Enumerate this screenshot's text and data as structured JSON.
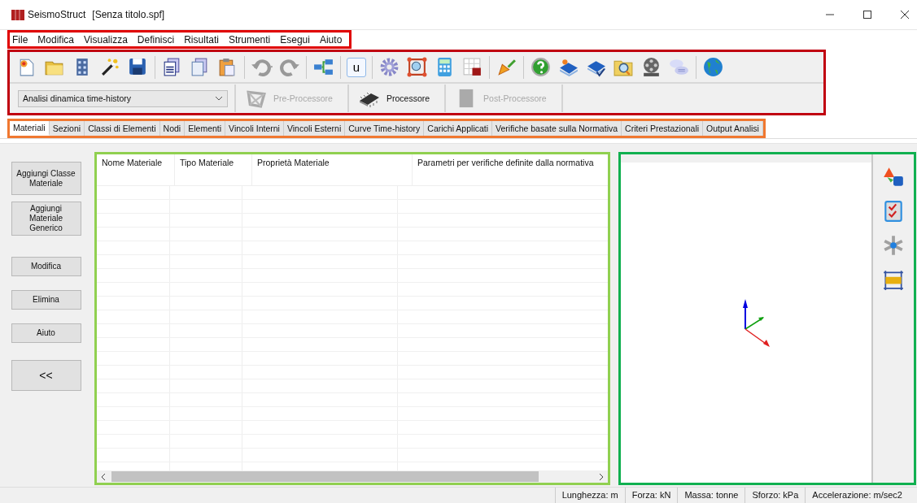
{
  "window": {
    "title": "SeismoStruct",
    "document": "[Senza titolo.spf]"
  },
  "menu": [
    "File",
    "Modifica",
    "Visualizza",
    "Definisci",
    "Risultati",
    "Strumenti",
    "Esegui",
    "Aiuto"
  ],
  "toolbar": {
    "text_button": "u"
  },
  "analysis": {
    "value": "Analisi dinamica time-history"
  },
  "modules": [
    {
      "label": "Pre-Processore",
      "kind": "pre",
      "disabled": true
    },
    {
      "label": "Processore",
      "kind": "proc",
      "disabled": false
    },
    {
      "label": "Post-Processore",
      "kind": "post",
      "disabled": true
    }
  ],
  "tabs": [
    {
      "label": "Materiali",
      "selected": true
    },
    {
      "label": "Sezioni",
      "selected": false
    },
    {
      "label": "Classi di Elementi",
      "selected": false
    },
    {
      "label": "Nodi",
      "selected": false
    },
    {
      "label": "Elementi",
      "selected": false
    },
    {
      "label": "Vincoli Interni",
      "selected": false
    },
    {
      "label": "Vincoli Esterni",
      "selected": false
    },
    {
      "label": "Curve Time-history",
      "selected": false
    },
    {
      "label": "Carichi Applicati",
      "selected": false
    },
    {
      "label": "Verifiche basate sulla Normativa",
      "selected": false
    },
    {
      "label": "Criteri Prestazionali",
      "selected": false
    },
    {
      "label": "Output Analisi",
      "selected": false
    }
  ],
  "side_buttons": [
    {
      "label": "Aggiungi Classe Materiale",
      "kind": "tall"
    },
    {
      "label": "Aggiungi Materiale Generico",
      "kind": "tall"
    },
    {
      "label": "Modifica",
      "kind": "small"
    },
    {
      "label": "Elimina",
      "kind": "small"
    },
    {
      "label": "Aiuto",
      "kind": "small"
    },
    {
      "label": "<<",
      "kind": "big"
    }
  ],
  "table": {
    "columns": [
      "Nome Materiale",
      "Tipo Materiale",
      "Proprietà Materiale",
      "Parametri per verifiche definite dalla normativa"
    ]
  },
  "status_bar": [
    "Lunghezza: m",
    "Forza: kN",
    "Massa: tonne",
    "Sforzo: kPa",
    "Accelerazione: m/sec2"
  ]
}
